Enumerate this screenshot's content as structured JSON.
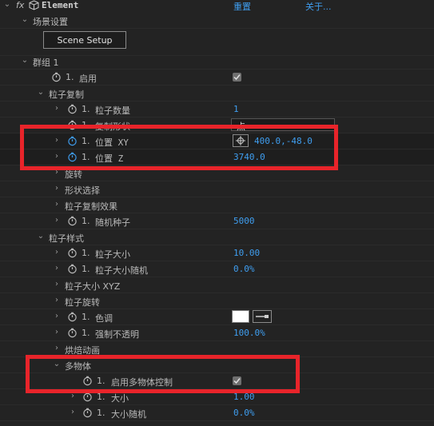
{
  "header": {
    "fx_label": "fx",
    "effect_name": "Element",
    "reset_label": "重置",
    "about_label": "关于..."
  },
  "scene_setup": {
    "group_label": "场景设置",
    "button_label": "Scene Setup"
  },
  "group1": {
    "label": "群组 1",
    "enable": {
      "index": "1.",
      "label": "启用",
      "checked": true
    },
    "particle_replicate": {
      "label": "粒子复制",
      "count": {
        "index": "1.",
        "label": "粒子数量",
        "value": "1"
      },
      "shape": {
        "index": "1.",
        "label": "复制形状",
        "value": "点"
      },
      "position_xy": {
        "index": "1.",
        "label": "位置 XY",
        "value": "400.0,-48.0"
      },
      "position_z": {
        "index": "1.",
        "label": "位置 Z",
        "value": "3740.0"
      },
      "rotation_label": "旋转",
      "shape_select_label": "形状选择",
      "replicate_effects_label": "粒子复制效果",
      "random_seed": {
        "index": "1.",
        "label": "随机种子",
        "value": "5000"
      }
    },
    "particle_style": {
      "label": "粒子样式",
      "size": {
        "index": "1.",
        "label": "粒子大小",
        "value": "10.00"
      },
      "size_random": {
        "index": "1.",
        "label": "粒子大小随机",
        "value": "0.0%"
      },
      "size_xyz_label": "粒子大小 XYZ",
      "rotation_label": "粒子旋转",
      "color": {
        "index": "1.",
        "label": "色调",
        "swatch_color": "#ffffff"
      },
      "force_opacity": {
        "index": "1.",
        "label": "强制不透明",
        "value": "100.0%"
      },
      "bake_anim_label": "烘焙动画",
      "multi_object": {
        "label": "多物体",
        "enable_control": {
          "index": "1.",
          "label": "启用多物体控制",
          "checked": true
        },
        "size": {
          "index": "1.",
          "label": "大小",
          "value": "1.00"
        },
        "size_random": {
          "index": "1.",
          "label": "大小随机",
          "value": "0.0%"
        }
      }
    }
  },
  "colors": {
    "value_blue": "#3f9ef0",
    "highlight_red": "#e8242a",
    "panel_bg": "#232323"
  }
}
